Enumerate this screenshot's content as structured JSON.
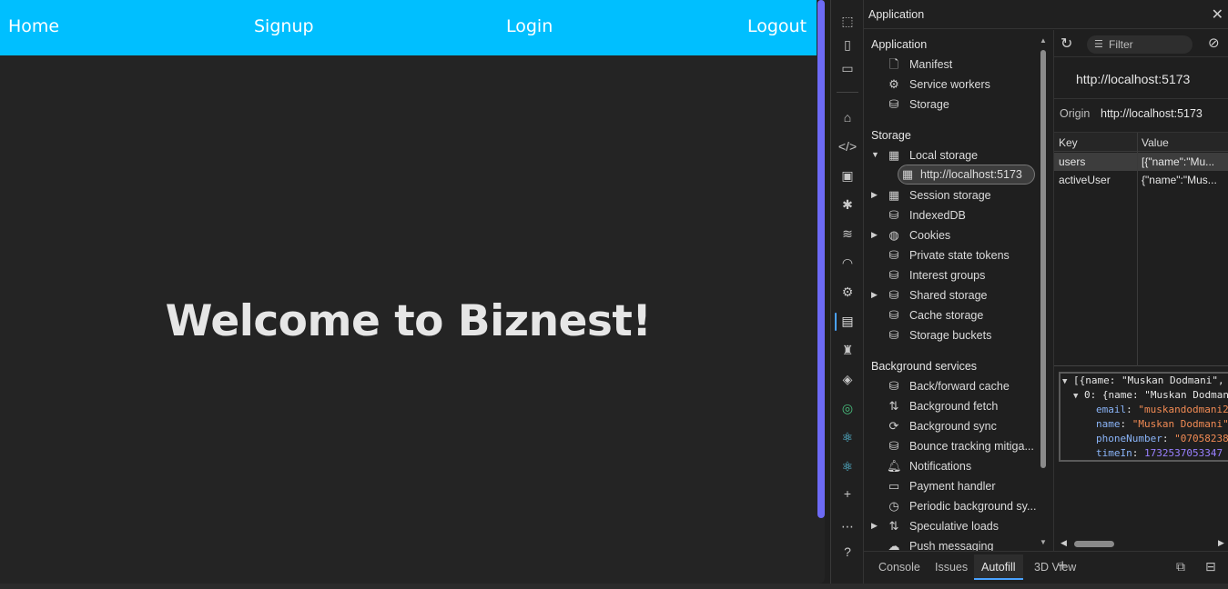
{
  "nav": {
    "home": "Home",
    "signup": "Signup",
    "login": "Login",
    "logout": "Logout"
  },
  "main": {
    "heading": "Welcome to Biznest!"
  },
  "devtools": {
    "title": "Application",
    "tree": {
      "application_header": "Application",
      "application_items": [
        "Manifest",
        "Service workers",
        "Storage"
      ],
      "storage_header": "Storage",
      "storage_items": [
        "Local storage",
        "http://localhost:5173",
        "Session storage",
        "IndexedDB",
        "Cookies",
        "Private state tokens",
        "Interest groups",
        "Shared storage",
        "Cache storage",
        "Storage buckets"
      ],
      "background_header": "Background services",
      "background_items": [
        "Back/forward cache",
        "Background fetch",
        "Background sync",
        "Bounce tracking mitiga...",
        "Notifications",
        "Payment handler",
        "Periodic background sy...",
        "Speculative loads",
        "Push messaging"
      ]
    },
    "toolbar": {
      "filter_placeholder": "Filter"
    },
    "origin": {
      "title": "http://localhost:5173",
      "label": "Origin",
      "value": "http://localhost:5173"
    },
    "table": {
      "headers": [
        "Key",
        "Value"
      ],
      "rows": [
        {
          "key": "users",
          "value": "[{\"name\":\"Mu..."
        },
        {
          "key": "activeUser",
          "value": "{\"name\":\"Mus..."
        }
      ]
    },
    "preview": {
      "line1": "[{name: \"Muskan Dodmani\",",
      "line2_prefix": "0: {name: \"Muskan Dodman",
      "email_key": "email",
      "email_val": "\"muskandodmani2",
      "name_key": "name",
      "name_val": "\"Muskan Dodmani\"",
      "phone_key": "phoneNumber",
      "phone_val": "\"070582384",
      "time_key": "timeIn",
      "time_val": "1732537053347"
    },
    "drawer": {
      "tabs": [
        "Console",
        "Issues",
        "Autofill",
        "3D View"
      ]
    }
  }
}
